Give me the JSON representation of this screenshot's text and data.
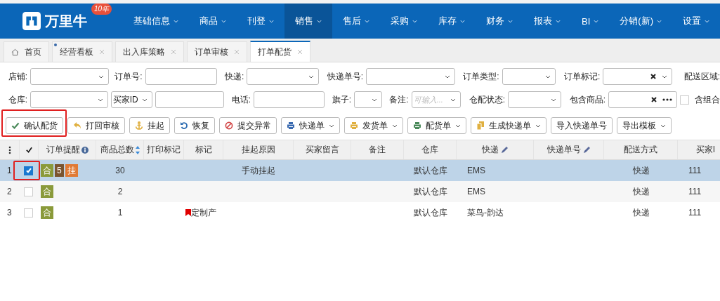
{
  "app": {
    "name": "万里牛",
    "badge": "10年"
  },
  "nav": [
    {
      "label": "基础信息",
      "selected": false
    },
    {
      "label": "商品",
      "selected": false
    },
    {
      "label": "刊登",
      "selected": false
    },
    {
      "label": "销售",
      "selected": true
    },
    {
      "label": "售后",
      "selected": false
    },
    {
      "label": "采购",
      "selected": false
    },
    {
      "label": "库存",
      "selected": false
    },
    {
      "label": "财务",
      "selected": false
    },
    {
      "label": "报表",
      "selected": false
    },
    {
      "label": "BI",
      "selected": false
    },
    {
      "label": "分销(新)",
      "selected": false
    },
    {
      "label": "设置",
      "selected": false
    }
  ],
  "tabs": [
    {
      "label": "首页",
      "kind": "home",
      "selected": false
    },
    {
      "label": "经营看板",
      "kind": "page",
      "selected": false,
      "dot": true
    },
    {
      "label": "出入库策略",
      "kind": "page",
      "selected": false,
      "dot": false
    },
    {
      "label": "订单审核",
      "kind": "page",
      "selected": false,
      "dot": false
    },
    {
      "label": "打单配货",
      "kind": "page",
      "selected": true,
      "dot": false
    }
  ],
  "filters": [
    [
      {
        "label": "店铺:",
        "kind": "select"
      },
      {
        "label": "订单号:",
        "kind": "input"
      },
      {
        "label": "快递:",
        "kind": "select"
      },
      {
        "label": "快递单号:",
        "kind": "select"
      },
      {
        "label": "订单类型:",
        "kind": "select"
      },
      {
        "label": "订单标记:",
        "kind": "clear-select"
      },
      {
        "label": "配送区域:",
        "kind": "label"
      }
    ],
    [
      {
        "label": "仓库:",
        "kind": "select"
      },
      {
        "kind": "select",
        "value": "买家ID"
      },
      {
        "kind": "input"
      },
      {
        "label": "电话:",
        "kind": "input"
      },
      {
        "label": "旗子:",
        "kind": "select"
      },
      {
        "label": "备注:",
        "kind": "select",
        "placeholder": "可输入..."
      },
      {
        "label": "仓配状态:",
        "kind": "select"
      },
      {
        "label": "包含商品:",
        "kind": "picker"
      },
      {
        "label": "含组合",
        "kind": "checkbox",
        "checked": false
      }
    ]
  ],
  "toolbar": [
    {
      "label": "确认配货",
      "kind": "check",
      "color": "#4a8a5a",
      "dropdown": false,
      "highlighted": true
    },
    {
      "label": "打回审核",
      "kind": "reply",
      "color": "#e0b040",
      "dropdown": false
    },
    {
      "label": "挂起",
      "kind": "anchor",
      "color": "#e0b040",
      "dropdown": false
    },
    {
      "label": "恢复",
      "kind": "undo",
      "color": "#2a6ab0",
      "dropdown": false
    },
    {
      "label": "提交异常",
      "kind": "ban",
      "color": "#d04040",
      "dropdown": false
    },
    {
      "label": "快递单",
      "kind": "printer",
      "color": "#3a6ab0",
      "dropdown": true
    },
    {
      "label": "发货单",
      "kind": "printer",
      "color": "#e0b040",
      "dropdown": true
    },
    {
      "label": "配货单",
      "kind": "printer",
      "color": "#4a8a5a",
      "dropdown": true
    },
    {
      "label": "生成快递单",
      "kind": "copy",
      "color": "#e0b040",
      "dropdown": true
    },
    {
      "label": "导入快递单号",
      "kind": "plain",
      "dropdown": false
    },
    {
      "label": "导出模板",
      "kind": "plain",
      "dropdown": true
    }
  ],
  "table": {
    "columns": [
      {
        "label": "订单提醒",
        "kind": "info"
      },
      {
        "label": "商品总数",
        "kind": "sort"
      },
      {
        "label": "打印标记",
        "kind": "plain"
      },
      {
        "label": "标记",
        "kind": "plain"
      },
      {
        "label": "挂起原因",
        "kind": "plain"
      },
      {
        "label": "买家留言",
        "kind": "plain"
      },
      {
        "label": "备注",
        "kind": "plain"
      },
      {
        "label": "仓库",
        "kind": "plain"
      },
      {
        "label": "快递",
        "kind": "edit"
      },
      {
        "label": "快递单号",
        "kind": "edit"
      },
      {
        "label": "配送方式",
        "kind": "plain"
      },
      {
        "label": "买家I",
        "kind": "plain"
      }
    ],
    "rows": [
      {
        "index": "1",
        "selected": true,
        "checked": true,
        "check_highlighted": true,
        "tags": [
          {
            "text": "合",
            "color": "#8a9a3a"
          },
          {
            "text": "5",
            "color": "#7a5530"
          },
          {
            "text": "挂",
            "color": "#e07a35"
          }
        ],
        "quantity": "30",
        "reason": "手动挂起",
        "warehouse": "默认仓库",
        "courier": "EMS",
        "delivery": "快递",
        "buyer_id": "111"
      },
      {
        "index": "2",
        "selected": false,
        "checked": false,
        "tags": [
          {
            "text": "合",
            "color": "#8a9a3a"
          }
        ],
        "quantity": "2",
        "warehouse": "默认仓库",
        "courier": "EMS",
        "delivery": "快递",
        "buyer_id": "111"
      },
      {
        "index": "3",
        "selected": false,
        "checked": false,
        "tags": [
          {
            "text": "合",
            "color": "#8a9a3a"
          }
        ],
        "quantity": "1",
        "mark": {
          "text": "定制产",
          "color": "#e00000"
        },
        "warehouse": "默认仓库",
        "courier": "菜鸟-韵达",
        "delivery": "快递",
        "buyer_id": "111"
      }
    ]
  }
}
